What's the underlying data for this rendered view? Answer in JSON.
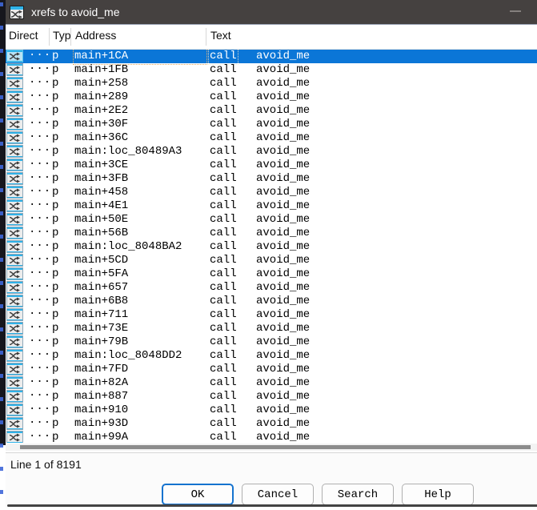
{
  "window": {
    "title": "xrefs to avoid_me"
  },
  "icons": {
    "titlebar_icon": "xref-shuffle-icon",
    "row_icon": "xref-shuffle-icon",
    "minimize": "minimize-dash-icon"
  },
  "colors": {
    "titlebar_bg": "#454140",
    "selection_blue": "#0b76d7",
    "icon_cyan": "#2fb2e8",
    "focus_dot_outline": "#e8b06a"
  },
  "table": {
    "columns": [
      "Direct",
      "Typ",
      "Address",
      "Text"
    ],
    "row_dots": "...",
    "selected_index": 0,
    "rows": [
      {
        "type": "p",
        "address": "main+1CA",
        "mnemonic": "call",
        "operand": "avoid_me"
      },
      {
        "type": "p",
        "address": "main+1FB",
        "mnemonic": "call",
        "operand": "avoid_me"
      },
      {
        "type": "p",
        "address": "main+258",
        "mnemonic": "call",
        "operand": "avoid_me"
      },
      {
        "type": "p",
        "address": "main+289",
        "mnemonic": "call",
        "operand": "avoid_me"
      },
      {
        "type": "p",
        "address": "main+2E2",
        "mnemonic": "call",
        "operand": "avoid_me"
      },
      {
        "type": "p",
        "address": "main+30F",
        "mnemonic": "call",
        "operand": "avoid_me"
      },
      {
        "type": "p",
        "address": "main+36C",
        "mnemonic": "call",
        "operand": "avoid_me"
      },
      {
        "type": "p",
        "address": "main:loc_80489A3",
        "mnemonic": "call",
        "operand": "avoid_me"
      },
      {
        "type": "p",
        "address": "main+3CE",
        "mnemonic": "call",
        "operand": "avoid_me"
      },
      {
        "type": "p",
        "address": "main+3FB",
        "mnemonic": "call",
        "operand": "avoid_me"
      },
      {
        "type": "p",
        "address": "main+458",
        "mnemonic": "call",
        "operand": "avoid_me"
      },
      {
        "type": "p",
        "address": "main+4E1",
        "mnemonic": "call",
        "operand": "avoid_me"
      },
      {
        "type": "p",
        "address": "main+50E",
        "mnemonic": "call",
        "operand": "avoid_me"
      },
      {
        "type": "p",
        "address": "main+56B",
        "mnemonic": "call",
        "operand": "avoid_me"
      },
      {
        "type": "p",
        "address": "main:loc_8048BA2",
        "mnemonic": "call",
        "operand": "avoid_me"
      },
      {
        "type": "p",
        "address": "main+5CD",
        "mnemonic": "call",
        "operand": "avoid_me"
      },
      {
        "type": "p",
        "address": "main+5FA",
        "mnemonic": "call",
        "operand": "avoid_me"
      },
      {
        "type": "p",
        "address": "main+657",
        "mnemonic": "call",
        "operand": "avoid_me"
      },
      {
        "type": "p",
        "address": "main+6B8",
        "mnemonic": "call",
        "operand": "avoid_me"
      },
      {
        "type": "p",
        "address": "main+711",
        "mnemonic": "call",
        "operand": "avoid_me"
      },
      {
        "type": "p",
        "address": "main+73E",
        "mnemonic": "call",
        "operand": "avoid_me"
      },
      {
        "type": "p",
        "address": "main+79B",
        "mnemonic": "call",
        "operand": "avoid_me"
      },
      {
        "type": "p",
        "address": "main:loc_8048DD2",
        "mnemonic": "call",
        "operand": "avoid_me"
      },
      {
        "type": "p",
        "address": "main+7FD",
        "mnemonic": "call",
        "operand": "avoid_me"
      },
      {
        "type": "p",
        "address": "main+82A",
        "mnemonic": "call",
        "operand": "avoid_me"
      },
      {
        "type": "p",
        "address": "main+887",
        "mnemonic": "call",
        "operand": "avoid_me"
      },
      {
        "type": "p",
        "address": "main+910",
        "mnemonic": "call",
        "operand": "avoid_me"
      },
      {
        "type": "p",
        "address": "main+93D",
        "mnemonic": "call",
        "operand": "avoid_me"
      },
      {
        "type": "p",
        "address": "main+99A",
        "mnemonic": "call",
        "operand": "avoid_me"
      }
    ]
  },
  "status": {
    "line_info": "Line 1 of 8191"
  },
  "buttons": {
    "ok": "OK",
    "cancel": "Cancel",
    "search": "Search",
    "help": "Help"
  }
}
